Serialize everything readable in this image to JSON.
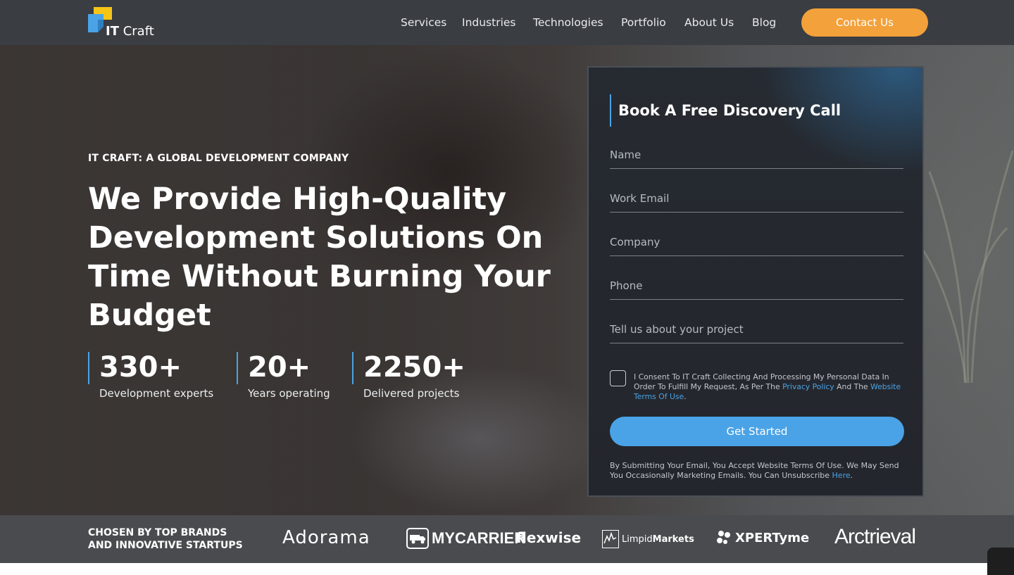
{
  "header": {
    "logo": {
      "text_prefix": "IT",
      "text_suffix": " Craft",
      "colors": {
        "yellow": "#f5c518",
        "blue": "#4aa3e6"
      }
    },
    "nav": [
      {
        "label": "Services"
      },
      {
        "label": "Industries"
      },
      {
        "label": "Technologies"
      },
      {
        "label": "Portfolio"
      },
      {
        "label": "About Us"
      },
      {
        "label": "Blog"
      }
    ],
    "contact_label": "Contact Us"
  },
  "hero": {
    "kicker": "IT CRAFT: A GLOBAL DEVELOPMENT COMPANY",
    "headline": "We Provide High-Quality Development Solutions On Time Without Burning Your Budget",
    "stats": [
      {
        "value": "330+",
        "label": "Development experts"
      },
      {
        "value": "20+",
        "label": "Years operating"
      },
      {
        "value": "2250+",
        "label": "Delivered projects"
      }
    ]
  },
  "form": {
    "title": "Book A Free Discovery Call",
    "fields": {
      "name": "Name",
      "email": "Work Email",
      "company": "Company",
      "phone": "Phone",
      "project": "Tell us about your project"
    },
    "consent": {
      "text_1": "I Consent To IT Craft Collecting And Processing My Personal Data In Order To Fulfill My Request, As Per The ",
      "privacy_link": "Privacy Policy",
      "text_2": " And The ",
      "terms_link": "Website Terms Of Use",
      "text_3": ".",
      "checked": false
    },
    "submit_label": "Get Started",
    "fine_print": "By Submitting Your Email, You Accept Website Terms Of Use. We May Send You Occasionally Marketing Emails. You Can Unsubscribe ",
    "fine_print_link": "Here",
    "fine_print_end": "."
  },
  "brands": {
    "title_line1": "CHOSEN BY TOP BRANDS",
    "title_line2": "AND INNOVATIVE STARTUPS",
    "logos": [
      "Adorama",
      "MYCARRIER",
      "flexwise",
      "Limpid",
      "Markets",
      "XPERTyme",
      "Arctrieval"
    ]
  },
  "colors": {
    "accent_orange": "#f3a13a",
    "accent_blue": "#4aa3e6",
    "header_bg": "#3a3d42"
  }
}
